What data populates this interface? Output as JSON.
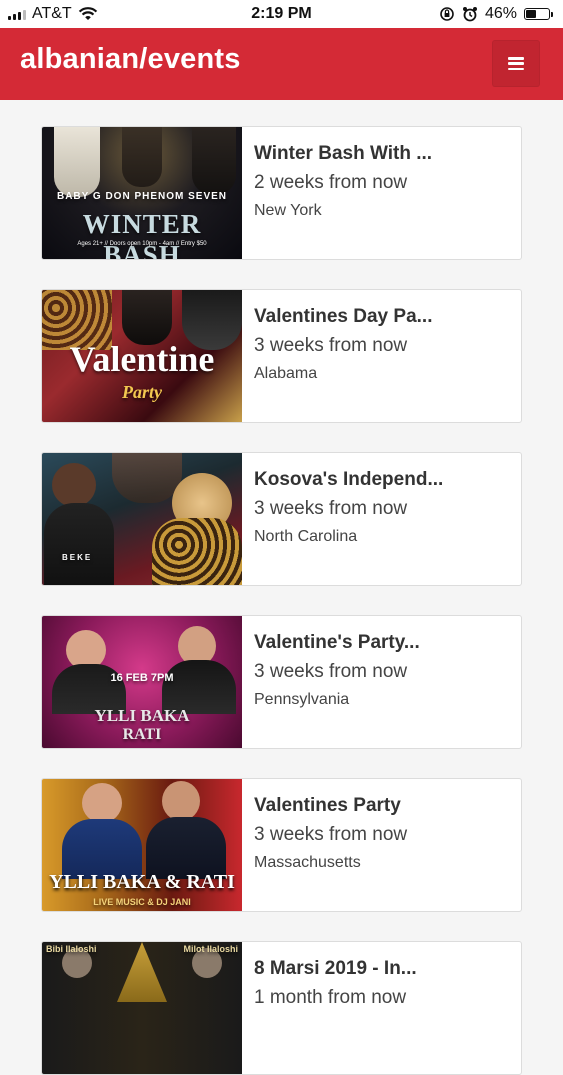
{
  "status_bar": {
    "carrier": "AT&T",
    "time": "2:19 PM",
    "battery_percent": "46%",
    "battery_level": 0.46
  },
  "header": {
    "brand": "albanian/events"
  },
  "events": [
    {
      "title": "Winter Bash With ...",
      "time": "2 weeks from now",
      "location": "New York",
      "poster": {
        "line1": "BABY G   DON PHENOM   SEVEN",
        "line2": "WINTER BASH",
        "line3": "Ages 21+ // Doors open 10pm - 4am // Entry $50"
      }
    },
    {
      "title": "Valentines Day Pa...",
      "time": "3 weeks from now",
      "location": "Alabama",
      "poster": {
        "line1": "Valentine",
        "line2": "Party"
      }
    },
    {
      "title": "Kosova's Independ...",
      "time": "3 weeks from now",
      "location": "North Carolina",
      "poster": {
        "line1": "BEKE"
      }
    },
    {
      "title": "Valentine's Party...",
      "time": "3 weeks from now",
      "location": "Pennsylvania",
      "poster": {
        "line1": "16 FEB 7PM",
        "line2": "YLLI BAKA",
        "line3": "RATI"
      }
    },
    {
      "title": "Valentines Party",
      "time": "3 weeks from now",
      "location": "Massachusetts",
      "poster": {
        "line1": "YLLI BAKA & RATI",
        "line2": "LIVE MUSIC & DJ JANI"
      }
    },
    {
      "title": "8 Marsi 2019 - In...",
      "time": "1 month from now",
      "location": "",
      "poster": {
        "line1": "Bibi Ilaloshi",
        "line2": "Milot Ilaloshi"
      }
    }
  ]
}
